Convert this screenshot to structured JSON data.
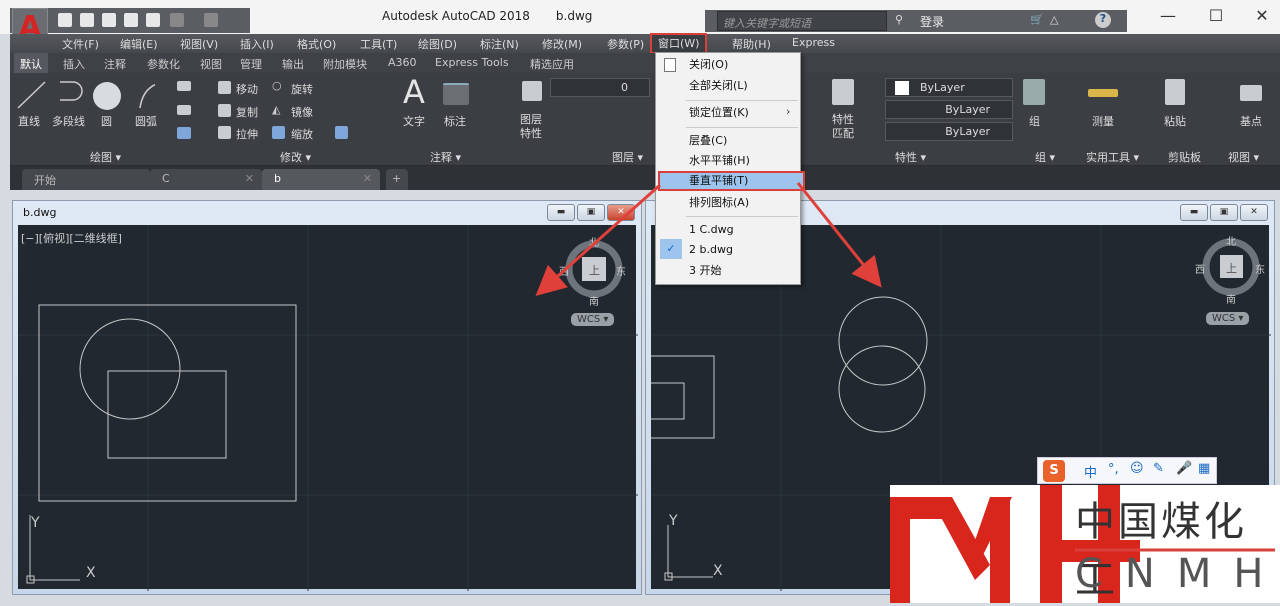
{
  "app": {
    "title": "Autodesk AutoCAD 2018",
    "file": "b.dwg",
    "logo_letter": "A"
  },
  "search": {
    "placeholder": "键入关键字或短语"
  },
  "user": {
    "login": "登录"
  },
  "window_controls": {
    "minimize": "—",
    "maximize": "☐",
    "close": "✕"
  },
  "menubar": [
    "文件(F)",
    "编辑(E)",
    "视图(V)",
    "插入(I)",
    "格式(O)",
    "工具(T)",
    "绘图(D)",
    "标注(N)",
    "修改(M)",
    "参数(P)",
    "窗口(W)",
    "帮助(H)",
    "Express"
  ],
  "ribbon_tabs": [
    "默认",
    "插入",
    "注释",
    "参数化",
    "视图",
    "管理",
    "输出",
    "附加模块",
    "A360",
    "Express Tools",
    "精选应用"
  ],
  "ribbon": {
    "draw": {
      "line": "直线",
      "polyline": "多段线",
      "circle": "圆",
      "arc": "圆弧",
      "panel": "绘图 ▾"
    },
    "modify": {
      "move": "移动",
      "rotate": "旋转",
      "copy": "复制",
      "mirror": "镜像",
      "stretch": "拉伸",
      "scale": "缩放",
      "panel": "修改 ▾"
    },
    "annotate": {
      "text": "文字",
      "dim": "标注",
      "panel": "注释 ▾"
    },
    "layers": {
      "props": "图层\n特性",
      "layer_value": "0",
      "panel": "图层 ▾"
    },
    "properties": {
      "match": "特性\n匹配",
      "color": "ByLayer",
      "linetype": "ByLayer",
      "lineweight": "ByLayer",
      "panel": "特性 ▾"
    },
    "groups": {
      "group": "组",
      "panel": "组 ▾"
    },
    "utilities": {
      "measure": "测量",
      "panel": "实用工具 ▾"
    },
    "clipboard": {
      "paste": "粘贴",
      "panel": "剪贴板"
    },
    "view": {
      "base": "基点",
      "panel": "视图 ▾"
    }
  },
  "file_tabs": [
    {
      "label": "开始"
    },
    {
      "label": "C",
      "close": "✕"
    },
    {
      "label": "b",
      "close": "✕"
    }
  ],
  "file_tab_add": "+",
  "left_window": {
    "title": "b.dwg",
    "viewport_label": "[−][俯视][二维线框]",
    "wcs": "WCS ▾",
    "cube": {
      "n": "北",
      "s": "南",
      "e": "东",
      "w": "西",
      "top": "上"
    },
    "ucs": {
      "x": "X",
      "y": "Y"
    }
  },
  "right_window": {
    "wcs": "WCS ▾",
    "cube": {
      "n": "北",
      "s": "南",
      "e": "东",
      "w": "西",
      "top": "上"
    },
    "ucs": {
      "x": "X",
      "y": "Y"
    }
  },
  "window_menu": {
    "items": [
      "关闭(O)",
      "全部关闭(L)",
      "锁定位置(K)",
      "层叠(C)",
      "水平平铺(H)",
      "垂直平铺(T)",
      "排列图标(A)",
      "1 C.dwg",
      "2 b.dwg",
      "3 开始"
    ],
    "submenu_arrow": "›",
    "checked": "✓",
    "highlighted": "垂直平铺(T)"
  },
  "ime": {
    "logo": "S",
    "mode": "中",
    "punct": "°,"
  },
  "watermark": {
    "mark": "MH",
    "cn": "中国煤化工",
    "en": "CNMHG"
  },
  "colors": {
    "accent": "#d9403a",
    "canvas": "#212830",
    "ribbon": "#3b3e43"
  }
}
